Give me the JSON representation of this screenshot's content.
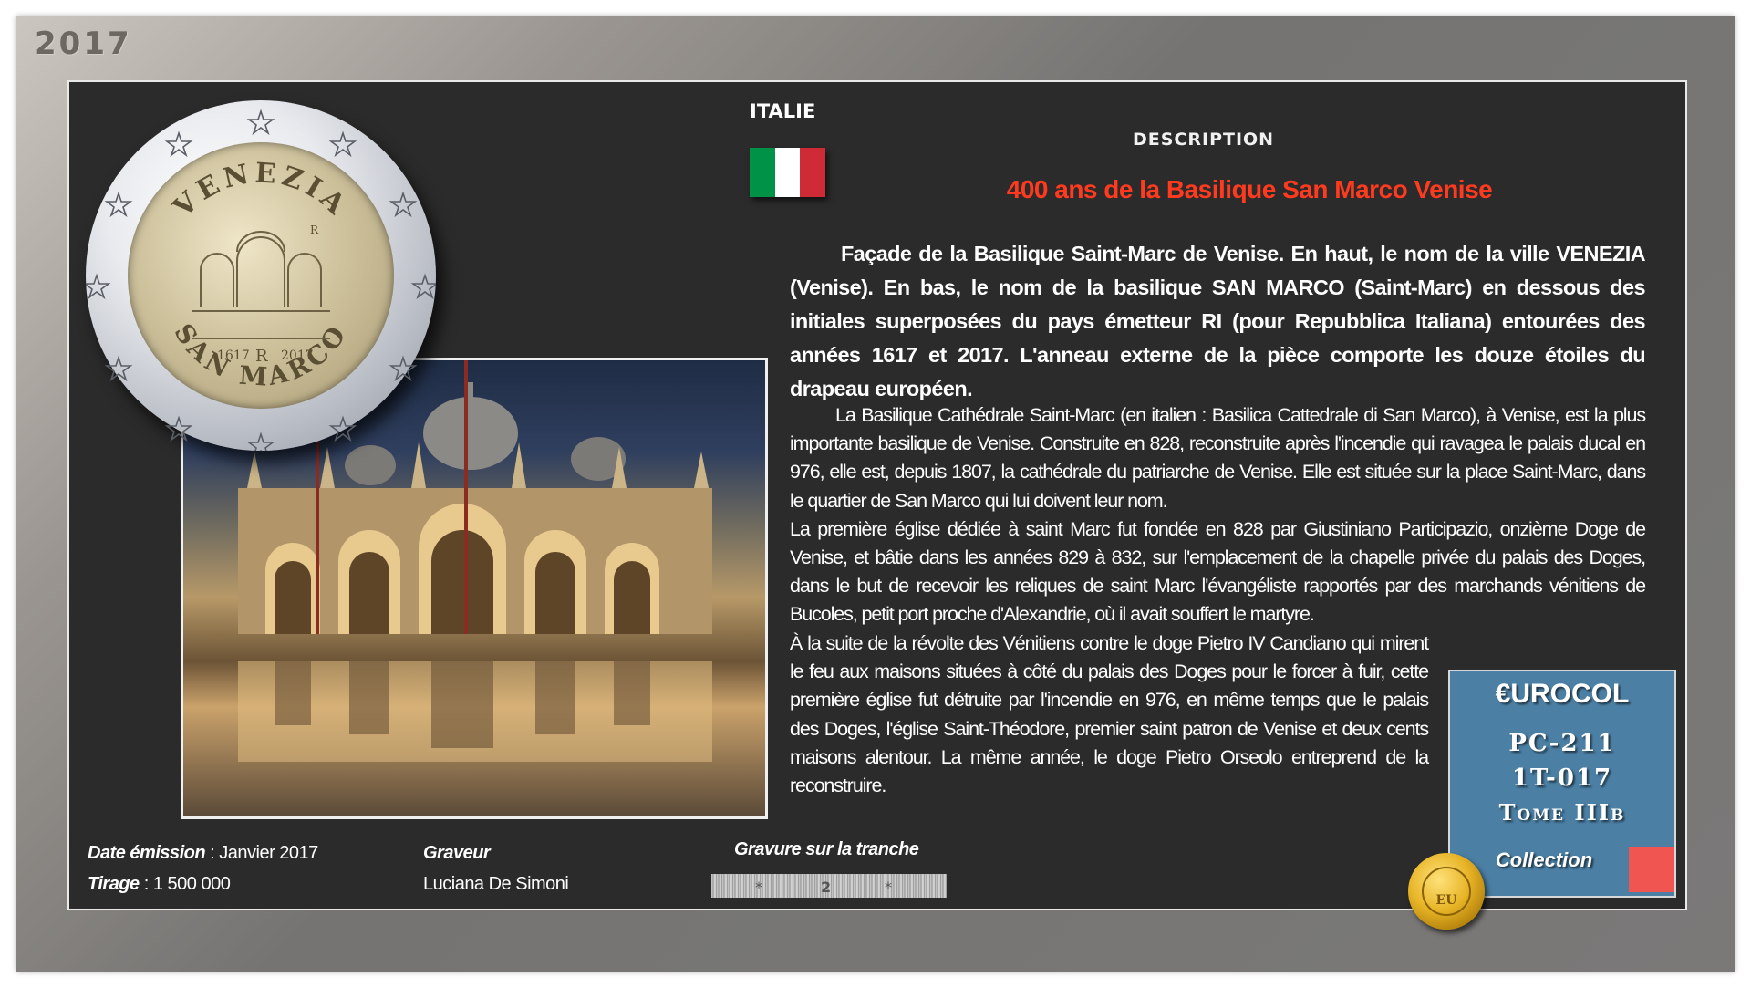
{
  "year": "2017",
  "country": "ITALIE",
  "flag_colors": [
    "#009246",
    "#ffffff",
    "#ce2b37"
  ],
  "description_label": "DESCRIPTION",
  "title": "400 ans de la Basilique San Marco Venise",
  "paragraph1": "Façade de la Basilique Saint-Marc de Venise. En haut, le nom de la ville VENEZIA (Venise). En bas, le nom de la basilique SAN MARCO (Saint-Marc) en dessous des initiales superposées du pays émetteur RI (pour Repubblica Italiana) entourées des années 1617 et 2017. L'anneau externe de la pièce comporte les douze étoiles du drapeau européen.",
  "paragraph2a": "La Basilique Cathédrale Saint-Marc (en italien  : Basilica Cattedrale di San Marco), à Venise, est la plus importante basilique de Venise. Construite en 828, reconstruite après l'incendie qui ravagea le palais ducal en 976, elle est, depuis 1807, la cathédrale du patriarche de Venise. Elle est située sur la place Saint-Marc, dans le quartier de San Marco qui lui doivent leur nom.",
  "paragraph2b": "La première église dédiée à saint Marc fut fondée en 828 par Giustiniano Participazio, onzième Doge de Venise, et bâtie dans les années 829 à 832, sur l'emplacement de la chapelle privée du palais des Doges, dans le but de recevoir les reliques de saint Marc l'évangéliste rapportés par des marchands vénitiens de Bucoles, petit port proche d'Alexandrie, où il avait souffert le martyre.",
  "paragraph3": "À la suite de la révolte des Vénitiens contre le doge Pietro IV Candiano qui mirent le feu aux maisons situées à côté du palais des Doges pour le forcer à fuir, cette première église fut détruite par l'incendie en 976, en même temps que le palais des Doges, l'église Saint-Théodore, premier saint patron de Venise et deux cents maisons alentour. La même année, le doge Pietro Orseolo entreprend de la reconstruire.",
  "coin": {
    "top_text": "VENEZIA",
    "bottom_text": "SAN MARCO",
    "year_left": "1617",
    "year_right": "2017",
    "mint_mark": "R",
    "monogram": "R"
  },
  "info": {
    "date_label": "Date émission",
    "date_value": "Janvier 2017",
    "tirage_label": "Tirage",
    "tirage_value": "1 500 000",
    "graveur_label": "Graveur",
    "graveur_value": "Luciana De Simoni",
    "tranche_label": "Gravure sur la tranche"
  },
  "collection_box": {
    "brand": "€UROCOL",
    "code1": "PC-211",
    "code2": "1T-017",
    "tome": "Tome IIIb",
    "collection_label": "Collection",
    "background": "#4b7fa4",
    "marker_color": "#f05552"
  },
  "seal_text": "EU"
}
